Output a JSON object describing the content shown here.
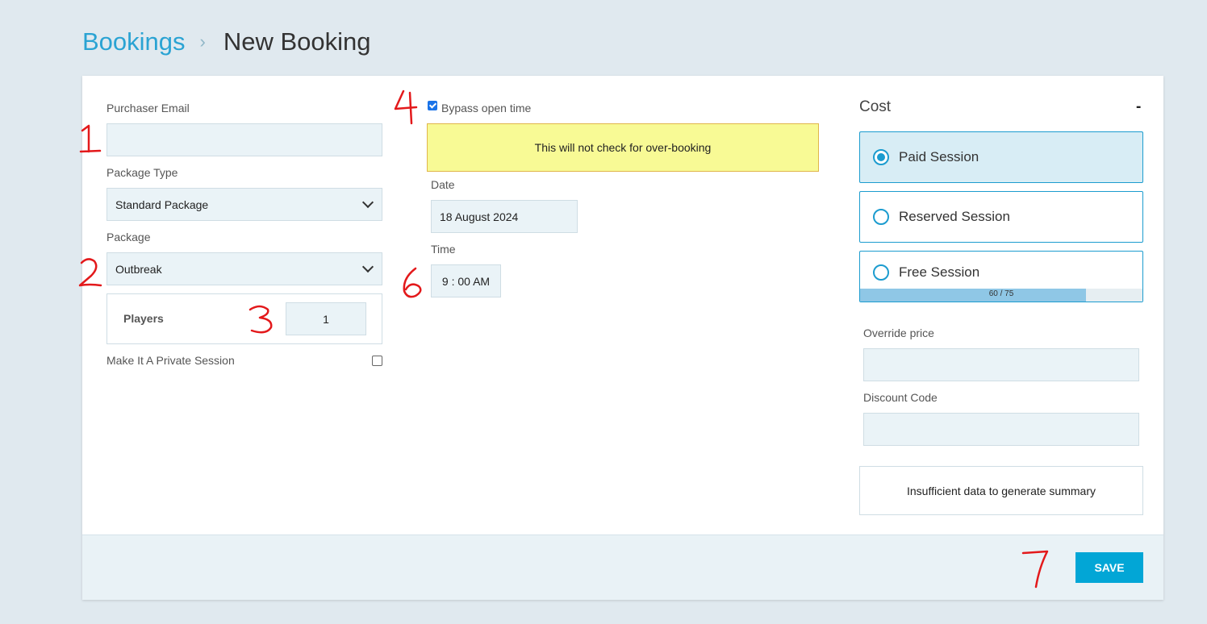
{
  "breadcrumb": {
    "parent": "Bookings",
    "separator": "›",
    "current": "New Booking"
  },
  "form": {
    "purchaser_email": {
      "label": "Purchaser Email",
      "value": ""
    },
    "package_type": {
      "label": "Package Type",
      "value": "Standard Package"
    },
    "package": {
      "label": "Package",
      "value": "Outbreak"
    },
    "players": {
      "label": "Players",
      "value": "1"
    },
    "private_session": {
      "label": "Make It A Private Session",
      "checked": false
    },
    "bypass": {
      "label": "Bypass open time",
      "checked": true
    },
    "warning": "This will not check for over-booking",
    "date": {
      "label": "Date",
      "value": "18 August 2024"
    },
    "time": {
      "label": "Time",
      "value": "9 : 00 AM"
    }
  },
  "cost": {
    "title": "Cost",
    "amount": "-",
    "sessions": [
      {
        "label": "Paid Session",
        "selected": true
      },
      {
        "label": "Reserved Session",
        "selected": false
      },
      {
        "label": "Free Session",
        "selected": false
      }
    ],
    "capacity": {
      "text": "60 / 75",
      "used": 60,
      "total": 75
    },
    "override_price": {
      "label": "Override price",
      "value": ""
    },
    "discount_code": {
      "label": "Discount Code",
      "value": ""
    },
    "summary": "Insufficient data to generate summary"
  },
  "footer": {
    "save_label": "SAVE"
  },
  "annotations": [
    "1",
    "2",
    "3",
    "4",
    "6",
    "7"
  ],
  "colors": {
    "accent": "#02a6d6",
    "warning_bg": "#f8fa95",
    "annotation": "#e3191b"
  }
}
